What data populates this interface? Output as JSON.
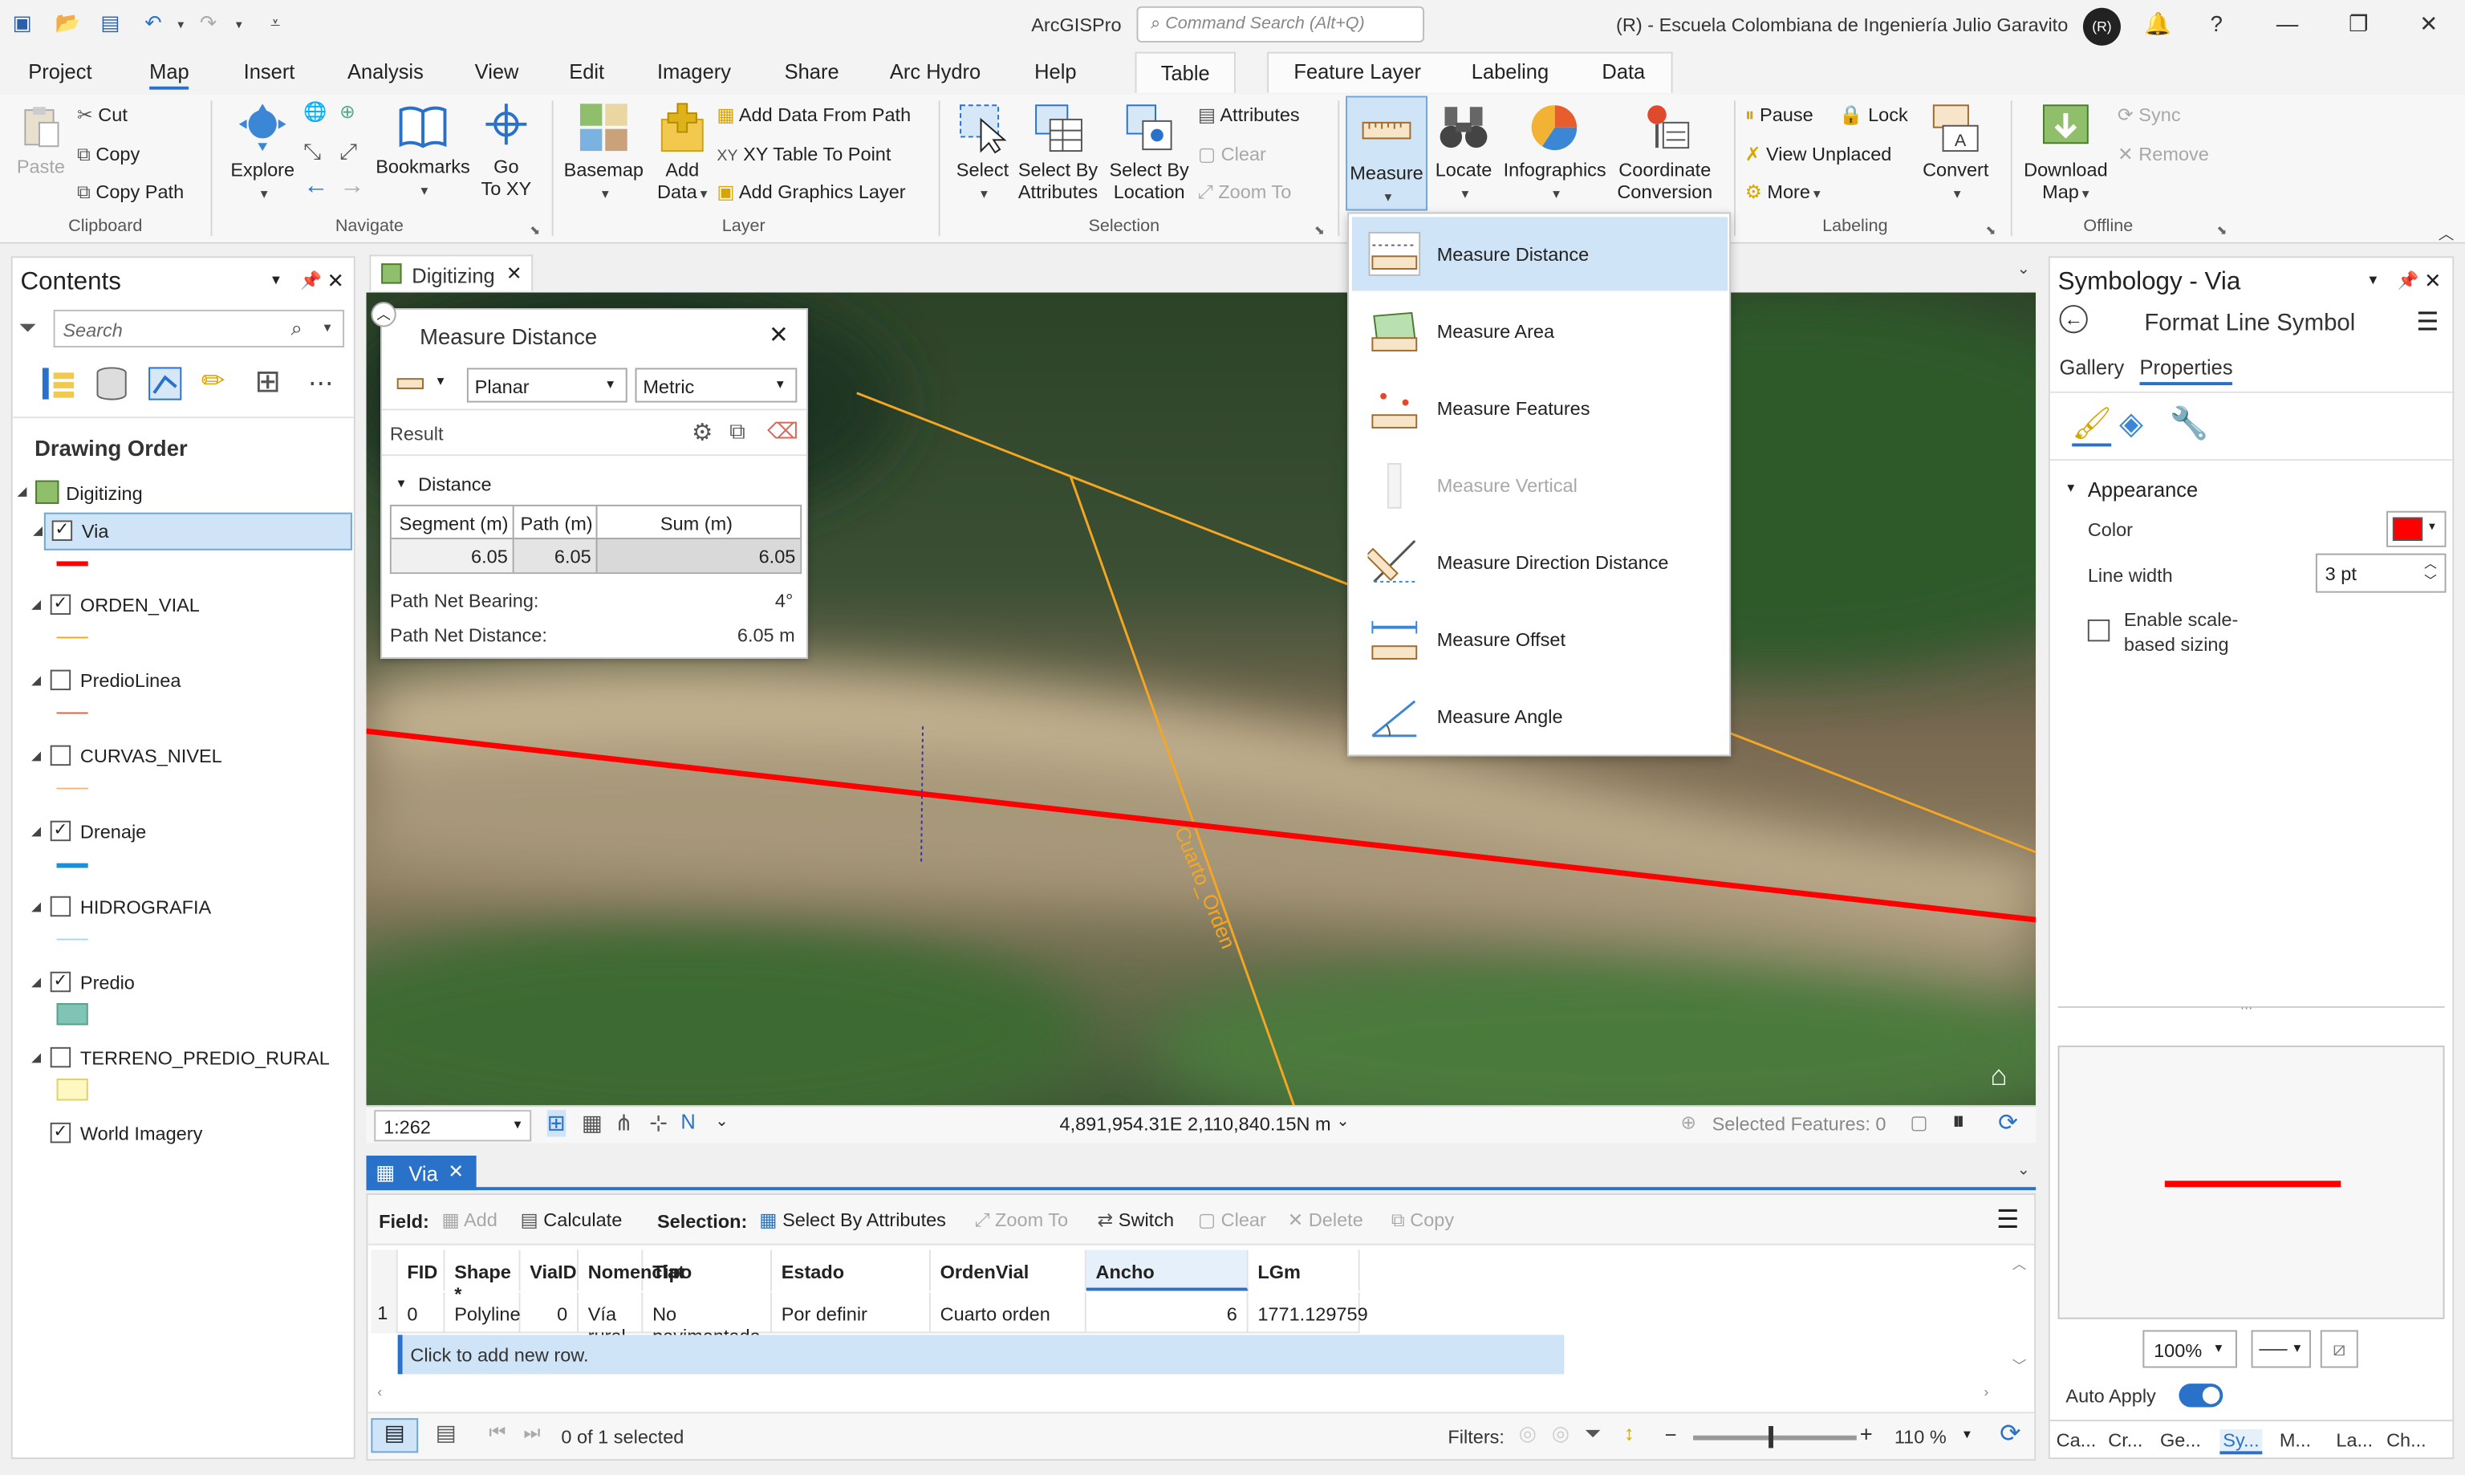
{
  "app": {
    "name": "ArcGISPro",
    "command_search_placeholder": "Command Search (Alt+Q)",
    "org": "(R) - Escuela Colombiana de Ingeniería Julio Garavito",
    "avatar_initials": "(R)"
  },
  "ribbon_tabs": [
    "Project",
    "Map",
    "Insert",
    "Analysis",
    "View",
    "Edit",
    "Imagery",
    "Share",
    "Arc Hydro",
    "Help"
  ],
  "context_tabs": {
    "table": "Table",
    "feature_layer": "Feature Layer",
    "labeling": "Labeling",
    "data": "Data"
  },
  "ribbon": {
    "clipboard": {
      "group": "Clipboard",
      "paste": "Paste",
      "cut": "Cut",
      "copy": "Copy",
      "copy_path": "Copy Path"
    },
    "navigate": {
      "group": "Navigate",
      "explore": "Explore",
      "bookmarks": "Bookmarks",
      "goto_line1": "Go",
      "goto_line2": "To XY"
    },
    "layer": {
      "group": "Layer",
      "basemap": "Basemap",
      "add_data_line1": "Add",
      "add_data_line2": "Data",
      "add_data_from_path": "Add Data From Path",
      "xy_table": "XY Table To Point",
      "add_graphics": "Add Graphics Layer"
    },
    "selection": {
      "group": "Selection",
      "select": "Select",
      "select_by_attr_line1": "Select By",
      "select_by_attr_line2": "Attributes",
      "select_by_loc_line1": "Select By",
      "select_by_loc_line2": "Location",
      "attributes": "Attributes",
      "clear": "Clear",
      "zoom_to": "Zoom To"
    },
    "inquiry": {
      "measure": "Measure",
      "locate": "Locate",
      "infographics": "Infographics",
      "coord_line1": "Coordinate",
      "coord_line2": "Conversion"
    },
    "labeling": {
      "group": "Labeling",
      "pause": "Pause",
      "lock": "Lock",
      "view_unplaced": "View Unplaced",
      "more": "More",
      "convert": "Convert"
    },
    "offline": {
      "group": "Offline",
      "download_line1": "Download",
      "download_line2": "Map",
      "sync": "Sync",
      "remove": "Remove"
    }
  },
  "measure_menu": [
    "Measure Distance",
    "Measure Area",
    "Measure Features",
    "Measure Vertical",
    "Measure Direction Distance",
    "Measure Offset",
    "Measure Angle"
  ],
  "contents": {
    "title": "Contents",
    "search_placeholder": "Search",
    "drawing_order": "Drawing Order",
    "map_name": "Digitizing",
    "layers": [
      {
        "name": "Via",
        "checked": true,
        "swatch": "#ff0000"
      },
      {
        "name": "ORDEN_VIAL",
        "checked": true,
        "swatch": "#f5a623"
      },
      {
        "name": "PredioLinea",
        "checked": false,
        "swatch": "#e8613c"
      },
      {
        "name": "CURVAS_NIVEL",
        "checked": false,
        "swatch": "#f2b880"
      },
      {
        "name": "Drenaje",
        "checked": true,
        "swatch": "#1b8fd8"
      },
      {
        "name": "HIDROGRAFIA",
        "checked": false,
        "swatch": "#a8d8f0"
      },
      {
        "name": "Predio",
        "checked": true,
        "swatch": "#7fc4b5"
      },
      {
        "name": "TERRENO_PREDIO_RURAL",
        "checked": false,
        "swatch": "#fff8c0"
      },
      {
        "name": "World Imagery",
        "checked": true,
        "swatch": ""
      }
    ]
  },
  "map": {
    "tab": "Digitizing",
    "road_label": "Cuarto_Orden",
    "scale": "1:262",
    "coordinates": "4,891,954.31E 2,110,840.15N m",
    "selected_features": "Selected Features: 0"
  },
  "measure_panel": {
    "title": "Measure Distance",
    "mode": "Planar",
    "units": "Metric",
    "result": "Result",
    "section": "Distance",
    "headers": [
      "Segment (m)",
      "Path (m)",
      "Sum (m)"
    ],
    "values": [
      "6.05",
      "6.05",
      "6.05"
    ],
    "bearing_label": "Path Net Bearing:",
    "bearing_value": "4°",
    "net_distance_label": "Path Net Distance:",
    "net_distance_value": "6.05 m"
  },
  "attribute_table": {
    "tab": "Via",
    "toolbar": {
      "field": "Field:",
      "add": "Add",
      "calculate": "Calculate",
      "selection": "Selection:",
      "select_by_attr": "Select By Attributes",
      "zoom_to": "Zoom To",
      "switch": "Switch",
      "clear": "Clear",
      "delete": "Delete",
      "copy": "Copy"
    },
    "columns": [
      "FID",
      "Shape *",
      "ViaID",
      "Nomenclat",
      "Tipo",
      "Estado",
      "OrdenVial",
      "Ancho",
      "LGm"
    ],
    "row": {
      "index": "1",
      "values": [
        "0",
        "Polyline",
        "0",
        "Vía rural",
        "No pavimentada",
        "Por definir",
        "Cuarto orden",
        "6",
        "1771.129759"
      ]
    },
    "add_row": "Click to add new row.",
    "status": "0 of 1 selected",
    "filters": "Filters:",
    "zoom": "110 %"
  },
  "symbology": {
    "title": "Symbology - Via",
    "subtitle": "Format Line Symbol",
    "tab_gallery": "Gallery",
    "tab_properties": "Properties",
    "appearance": "Appearance",
    "color_label": "Color",
    "color": "#ff0000",
    "line_width_label": "Line width",
    "line_width": "3 pt",
    "scale_sizing_line1": "Enable scale-",
    "scale_sizing_line2": "based sizing",
    "zoom": "100%",
    "auto_apply": "Auto Apply",
    "bottom_tabs": [
      "Ca...",
      "Cr...",
      "Ge...",
      "Sy...",
      "M...",
      "La...",
      "Ch..."
    ]
  }
}
